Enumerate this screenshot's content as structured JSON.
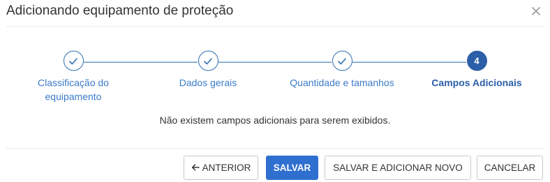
{
  "dialog": {
    "title": "Adicionando equipamento de proteção",
    "close_icon": "close-icon"
  },
  "stepper": {
    "steps": [
      {
        "label": "Classificação do equipamento",
        "state": "completed",
        "icon": "check-icon"
      },
      {
        "label": "Dados gerais",
        "state": "completed",
        "icon": "check-icon"
      },
      {
        "label": "Quantidade e tamanhos",
        "state": "completed",
        "icon": "check-icon"
      },
      {
        "label": "Campos Adicionais",
        "state": "active",
        "number": "4"
      }
    ]
  },
  "content": {
    "empty_message": "Não existem campos adicionais para serem exibidos."
  },
  "footer": {
    "previous_label": "ANTERIOR",
    "previous_icon": "arrow-left-icon",
    "save_label": "SALVAR",
    "save_and_new_label": "SALVAR E ADICIONAR NOVO",
    "cancel_label": "CANCELAR"
  },
  "colors": {
    "accent": "#2f6fd0",
    "step_line": "#2f6fb3",
    "step_text": "#3a7bc8"
  }
}
